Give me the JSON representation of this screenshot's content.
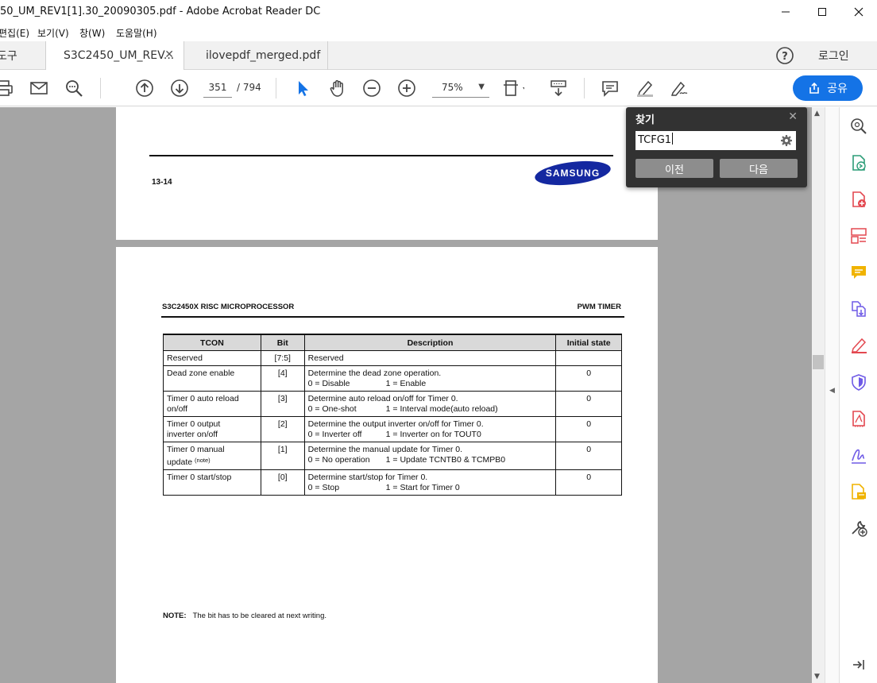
{
  "window": {
    "title": "50_UM_REV1[1].30_20090305.pdf - Adobe Acrobat Reader DC"
  },
  "menu": [
    "편집(E)",
    "보기(V)",
    "창(W)",
    "도움말(H)"
  ],
  "tabs": {
    "tools": "도구",
    "active": "S3C2450_UM_REV...",
    "second": "ilovepdf_merged.pdf",
    "login": "로그인"
  },
  "toolbar": {
    "page_current": "351",
    "page_total": "/  794",
    "zoom": "75%",
    "share_label": "공유"
  },
  "page1": {
    "page_number": "13-14",
    "logo_text": "SAMSUNG"
  },
  "page2": {
    "header_left": "S3C2450X RISC MICROPROCESSOR",
    "header_right": "PWM TIMER",
    "table": {
      "headers": [
        "TCON",
        "Bit",
        "Description",
        "Initial state"
      ],
      "rows": [
        {
          "name1": "Reserved",
          "name2": "",
          "bit": "[7:5]",
          "d1": "Reserved",
          "o1": "",
          "o2": "",
          "init": ""
        },
        {
          "name1": "Dead zone enable",
          "name2": "",
          "bit": "[4]",
          "d1": "Determine the dead zone operation.",
          "o1": "0 = Disable",
          "o2": "1 = Enable",
          "init": "0"
        },
        {
          "name1": "Timer 0 auto reload",
          "name2": "on/off",
          "bit": "[3]",
          "d1": "Determine auto reload on/off for Timer 0.",
          "o1": "0 = One-shot",
          "o2": "1 = Interval mode(auto reload)",
          "init": "0"
        },
        {
          "name1": "Timer 0 output",
          "name2": "inverter on/off",
          "bit": "[2]",
          "d1": "Determine the output inverter on/off for Timer 0.",
          "o1": "0 = Inverter off",
          "o2": "1 = Inverter on for TOUT0",
          "init": "0"
        },
        {
          "name1": "Timer 0 manual",
          "name2": "update",
          "name_sup": "(note)",
          "bit": "[1]",
          "d1": "Determine the manual update for Timer 0.",
          "o1": "0 = No operation",
          "o2": "1 = Update TCNTB0 & TCMPB0",
          "init": "0"
        },
        {
          "name1": "Timer 0 start/stop",
          "name2": "",
          "bit": "[0]",
          "d1": "Determine start/stop for Timer 0.",
          "o1": "0 = Stop",
          "o2": "1 = Start for Timer 0",
          "init": "0"
        }
      ]
    },
    "note_label": "NOTE:",
    "note_text": "The bit has to be cleared at next writing."
  },
  "find": {
    "title": "찾기",
    "query": "TCFG1",
    "prev": "이전",
    "next": "다음"
  },
  "colors": {
    "accent": "#1473e6",
    "doc_bg": "#a5a5a5",
    "find_bg": "#323232"
  }
}
